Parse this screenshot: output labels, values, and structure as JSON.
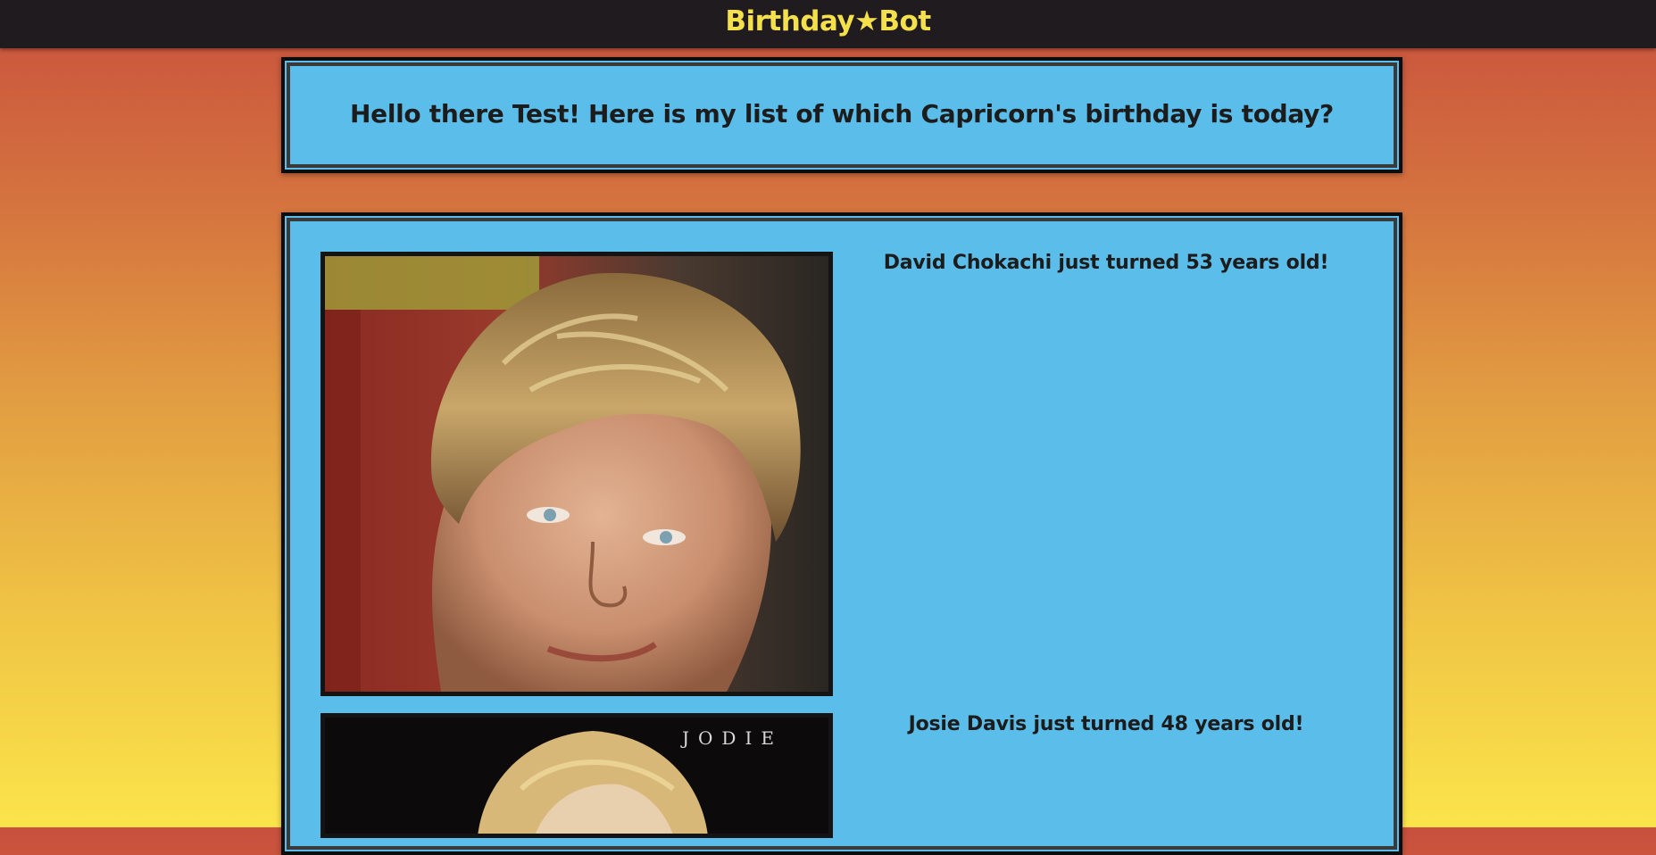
{
  "header": {
    "brand": "Birthday★Bot"
  },
  "greeting": {
    "text": "Hello there Test! Here is my list of which Capricorn's birthday is today?"
  },
  "birthdays": [
    {
      "caption": "David Chokachi just turned 53 years old!"
    },
    {
      "caption": "Josie Davis just turned 48 years old!"
    }
  ],
  "colors": {
    "topbar": "#1f1b1f",
    "brand": "#f4e04a",
    "card": "#5bbdea",
    "card_border": "#0d0d0d",
    "gradient_top": "#c8503e",
    "gradient_bottom": "#fbe44a"
  }
}
